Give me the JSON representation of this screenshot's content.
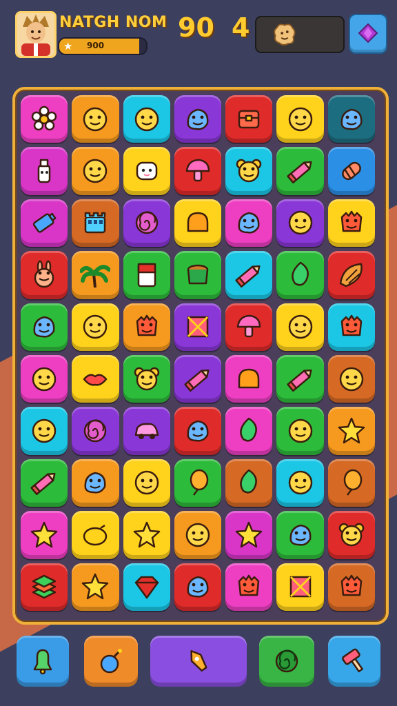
{
  "player": {
    "name": "NATGH NOM",
    "xp_value": "900",
    "xp_fraction": 0.92,
    "star_icon": "star-icon"
  },
  "hud": {
    "score": "90",
    "moves": "4",
    "target_icon": "cookie-icon",
    "shop_icon": "diamond-icon"
  },
  "colors": {
    "pink": "#ee3fc3",
    "orange": "#f59a1f",
    "cyan": "#1cc7e6",
    "purple": "#8a37d8",
    "red": "#e02b2b",
    "yellow": "#ffd21c",
    "teal": "#1d6d80",
    "green": "#2dbb3b",
    "blue": "#2c8fe6",
    "rust": "#d66a25",
    "magenta": "#d936c8",
    "lime": "#5ccf2e"
  },
  "board": {
    "rows": [
      [
        {
          "c": "pink",
          "i": "flower"
        },
        {
          "c": "orange",
          "i": "smiley"
        },
        {
          "c": "cyan",
          "i": "smiley"
        },
        {
          "c": "purple",
          "i": "blob"
        },
        {
          "c": "red",
          "i": "chest"
        },
        {
          "c": "yellow",
          "i": "smiley"
        },
        {
          "c": "teal",
          "i": "blob"
        }
      ],
      [
        {
          "c": "magenta",
          "i": "bottle"
        },
        {
          "c": "orange",
          "i": "smiley"
        },
        {
          "c": "yellow",
          "i": "ghost"
        },
        {
          "c": "red",
          "i": "mushroom"
        },
        {
          "c": "cyan",
          "i": "bear"
        },
        {
          "c": "green",
          "i": "pencil"
        },
        {
          "c": "blue",
          "i": "candy"
        }
      ],
      [
        {
          "c": "magenta",
          "i": "battery"
        },
        {
          "c": "rust",
          "i": "castle"
        },
        {
          "c": "purple",
          "i": "swirl"
        },
        {
          "c": "yellow",
          "i": "dome"
        },
        {
          "c": "pink",
          "i": "blob"
        },
        {
          "c": "purple",
          "i": "smiley"
        },
        {
          "c": "yellow",
          "i": "monster"
        }
      ],
      [
        {
          "c": "red",
          "i": "bunny"
        },
        {
          "c": "orange",
          "i": "palm"
        },
        {
          "c": "green",
          "i": "card"
        },
        {
          "c": "green",
          "i": "pot"
        },
        {
          "c": "cyan",
          "i": "pencil"
        },
        {
          "c": "green",
          "i": "leaf"
        },
        {
          "c": "red",
          "i": "shell"
        }
      ],
      [
        {
          "c": "green",
          "i": "blob"
        },
        {
          "c": "yellow",
          "i": "smiley"
        },
        {
          "c": "orange",
          "i": "monster"
        },
        {
          "c": "purple",
          "i": "box"
        },
        {
          "c": "red",
          "i": "mushroom"
        },
        {
          "c": "yellow",
          "i": "smiley"
        },
        {
          "c": "cyan",
          "i": "monster"
        }
      ],
      [
        {
          "c": "pink",
          "i": "smiley"
        },
        {
          "c": "yellow",
          "i": "lips"
        },
        {
          "c": "green",
          "i": "bear"
        },
        {
          "c": "purple",
          "i": "pencil"
        },
        {
          "c": "pink",
          "i": "dome"
        },
        {
          "c": "green",
          "i": "pencil"
        },
        {
          "c": "rust",
          "i": "smiley"
        }
      ],
      [
        {
          "c": "cyan",
          "i": "smiley"
        },
        {
          "c": "purple",
          "i": "swirl"
        },
        {
          "c": "purple",
          "i": "car"
        },
        {
          "c": "red",
          "i": "blob"
        },
        {
          "c": "pink",
          "i": "leaf"
        },
        {
          "c": "green",
          "i": "smiley"
        },
        {
          "c": "orange",
          "i": "star"
        }
      ],
      [
        {
          "c": "green",
          "i": "pencil"
        },
        {
          "c": "orange",
          "i": "blob"
        },
        {
          "c": "yellow",
          "i": "smiley"
        },
        {
          "c": "green",
          "i": "balloon"
        },
        {
          "c": "rust",
          "i": "leaf"
        },
        {
          "c": "cyan",
          "i": "smiley"
        },
        {
          "c": "rust",
          "i": "balloon"
        }
      ],
      [
        {
          "c": "pink",
          "i": "star"
        },
        {
          "c": "yellow",
          "i": "lemon"
        },
        {
          "c": "yellow",
          "i": "star"
        },
        {
          "c": "orange",
          "i": "smiley"
        },
        {
          "c": "magenta",
          "i": "star"
        },
        {
          "c": "green",
          "i": "blob"
        },
        {
          "c": "red",
          "i": "bear"
        }
      ],
      [
        {
          "c": "red",
          "i": "cake"
        },
        {
          "c": "orange",
          "i": "star"
        },
        {
          "c": "cyan",
          "i": "gem"
        },
        {
          "c": "red",
          "i": "blob"
        },
        {
          "c": "pink",
          "i": "monster"
        },
        {
          "c": "yellow",
          "i": "box"
        },
        {
          "c": "rust",
          "i": "monster"
        }
      ]
    ]
  },
  "toolbar": {
    "items": [
      {
        "name": "bell-boost-button",
        "color": "#3a9be6",
        "icon": "bell"
      },
      {
        "name": "bomb-boost-button",
        "color": "#f08b2a",
        "icon": "bomb"
      },
      {
        "name": "rocket-boost-button",
        "color": "#8a4fe0",
        "icon": "rocket"
      },
      {
        "name": "swirl-boost-button",
        "color": "#38b545",
        "icon": "swirl"
      },
      {
        "name": "hammer-boost-button",
        "color": "#37a7ea",
        "icon": "hammer"
      }
    ]
  }
}
